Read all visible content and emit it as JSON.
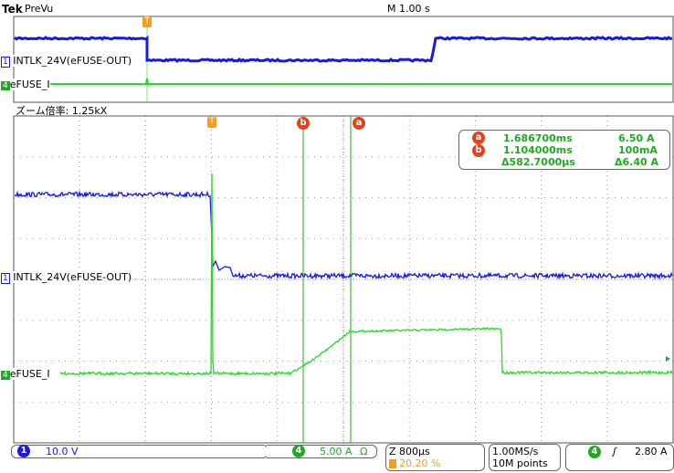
{
  "header": {
    "brand": "Tek",
    "mode": "PreVu",
    "timebase": "M 1.00 s"
  },
  "zoom_label": "ズーム倍率: 1.25kX",
  "channels": {
    "ch1": {
      "number": "1",
      "label": "INTLK_24V(eFUSE-OUT)",
      "scale": "10.0 V",
      "color": "#1a1adf"
    },
    "ch4": {
      "number": "4",
      "label": "eFUSE_I",
      "scale": "5.00 A",
      "coupling": "Ω",
      "color": "#22dd22"
    }
  },
  "cursors": {
    "a": {
      "label": "a",
      "time": "1.686700ms",
      "value": "6.50 A"
    },
    "b": {
      "label": "b",
      "time": "1.104000ms",
      "value": "100mA"
    },
    "delta": {
      "time": "Δ582.7000µs",
      "value": "Δ6.40 A"
    }
  },
  "trigger_marker": "T",
  "status": {
    "zoom_timebase": "Z 800µs",
    "trigger_pos": "20.20 %",
    "sample_rate": "1.00MS/s",
    "record_length": "10M points",
    "trigger_channel": "4",
    "trigger_slope": "ʃ",
    "trigger_level": "2.80 A"
  },
  "colors": {
    "cursor_orange": "#e8401a",
    "trigger_orange": "#f0a020",
    "ch1": "#1a1adf",
    "ch4": "#22dd22"
  }
}
